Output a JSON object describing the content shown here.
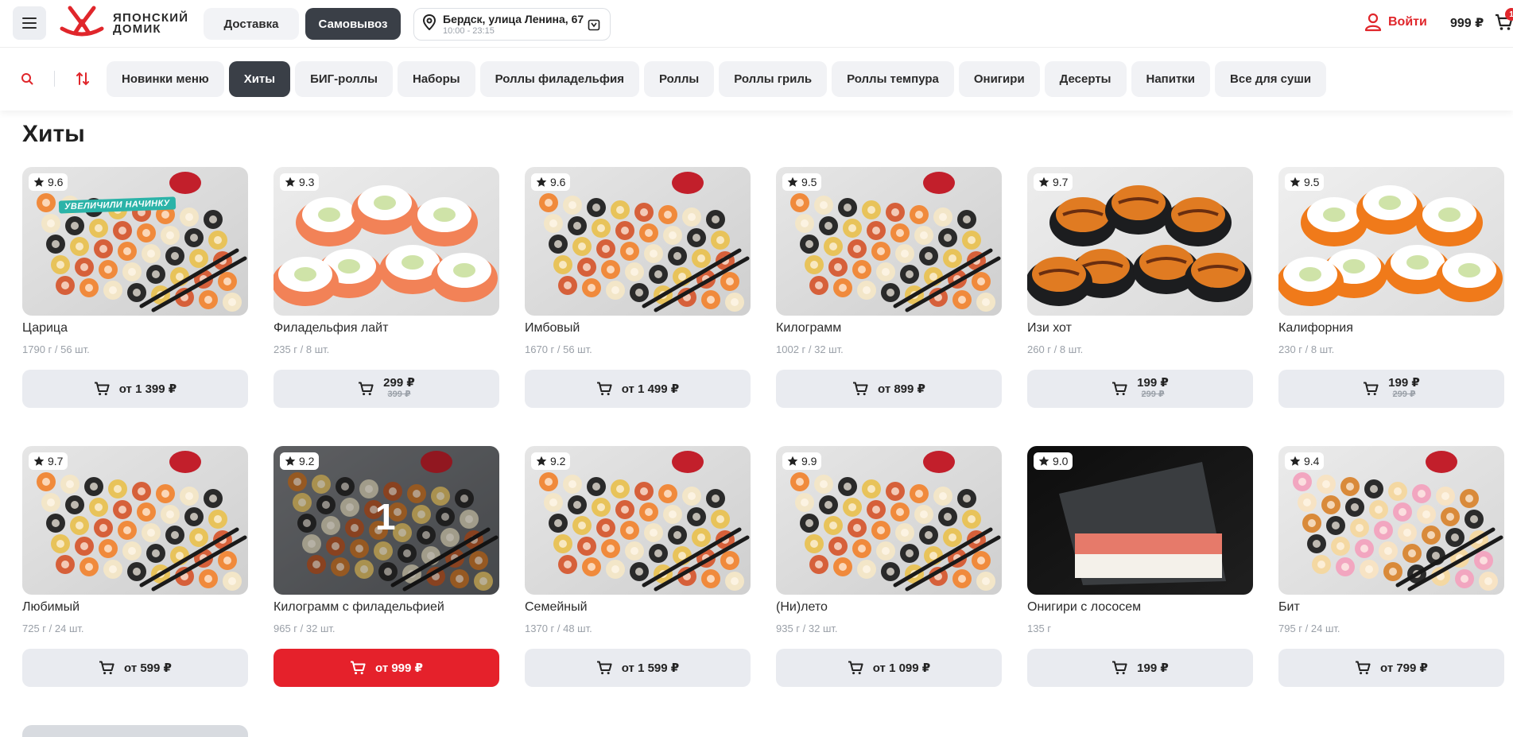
{
  "header": {
    "logo_line1": "ЯПОНСКИЙ",
    "logo_line2": "ДОМИК",
    "delivery_label": "Доставка",
    "pickup_label": "Самовывоз",
    "address": "Бердск, улица Ленина, 67",
    "hours": "10:00 - 23:15",
    "login_label": "Войти",
    "cart_total": "999 ₽",
    "cart_count": "1"
  },
  "categories": [
    {
      "label": "Новинки меню",
      "active": false
    },
    {
      "label": "Хиты",
      "active": true
    },
    {
      "label": "БИГ-роллы",
      "active": false
    },
    {
      "label": "Наборы",
      "active": false
    },
    {
      "label": "Роллы филадельфия",
      "active": false
    },
    {
      "label": "Роллы",
      "active": false
    },
    {
      "label": "Роллы гриль",
      "active": false
    },
    {
      "label": "Роллы темпура",
      "active": false
    },
    {
      "label": "Онигири",
      "active": false
    },
    {
      "label": "Десерты",
      "active": false
    },
    {
      "label": "Напитки",
      "active": false
    },
    {
      "label": "Все для суши",
      "active": false
    }
  ],
  "section": {
    "title": "Хиты"
  },
  "products": [
    {
      "name": "Царица",
      "weight": "1790 г / 56 шт.",
      "rating": "9.6",
      "price": "от 1 399 ₽",
      "old_price": "",
      "promo": "УВЕЛИЧИЛИ НАЧИНКУ",
      "button": "gray",
      "image": "set-mix"
    },
    {
      "name": "Филадельфия лайт",
      "weight": "235 г / 8 шт.",
      "rating": "9.3",
      "price": "299 ₽",
      "old_price": "399 ₽",
      "promo": "",
      "button": "gray",
      "image": "salmon-roll"
    },
    {
      "name": "Имбовый",
      "weight": "1670 г / 56 шт.",
      "rating": "9.6",
      "price": "от 1 499 ₽",
      "old_price": "",
      "promo": "",
      "button": "gray",
      "image": "set-mix"
    },
    {
      "name": "Килограмм",
      "weight": "1002 г / 32 шт.",
      "rating": "9.5",
      "price": "от 899 ₽",
      "old_price": "",
      "promo": "",
      "button": "gray",
      "image": "set-mix"
    },
    {
      "name": "Изи хот",
      "weight": "260 г / 8 шт.",
      "rating": "9.7",
      "price": "199 ₽",
      "old_price": "299 ₽",
      "promo": "",
      "button": "gray",
      "image": "baked-roll"
    },
    {
      "name": "Калифорния",
      "weight": "230 г / 8 шт.",
      "rating": "9.5",
      "price": "199 ₽",
      "old_price": "299 ₽",
      "promo": "",
      "button": "gray",
      "image": "caviar-roll"
    },
    {
      "name": "Любимый",
      "weight": "725 г / 24 шт.",
      "rating": "9.7",
      "price": "от 599 ₽",
      "old_price": "",
      "promo": "",
      "button": "gray",
      "image": "set-mix"
    },
    {
      "name": "Килограмм с филадельфией",
      "weight": "965 г / 32 шт.",
      "rating": "9.2",
      "price": "от 999 ₽",
      "old_price": "",
      "promo": "",
      "button": "red",
      "image": "set-dark",
      "overlay_number": "1"
    },
    {
      "name": "Семейный",
      "weight": "1370 г / 48 шт.",
      "rating": "9.2",
      "price": "от 1 599 ₽",
      "old_price": "",
      "promo": "",
      "button": "gray",
      "image": "set-mix"
    },
    {
      "name": "(Ни)лето",
      "weight": "935 г / 32 шт.",
      "rating": "9.9",
      "price": "от 1 099 ₽",
      "old_price": "",
      "promo": "",
      "button": "gray",
      "image": "set-mix"
    },
    {
      "name": "Онигири с лососем",
      "weight": "135 г",
      "rating": "9.0",
      "price": "199 ₽",
      "old_price": "",
      "promo": "",
      "button": "gray",
      "image": "onigiri"
    },
    {
      "name": "Бит",
      "weight": "795 г / 24 шт.",
      "rating": "9.4",
      "price": "от 799 ₽",
      "old_price": "",
      "promo": "",
      "button": "gray",
      "image": "set-pink"
    }
  ],
  "colors": {
    "accent": "#e5212b",
    "dark_pill": "#3a3f47",
    "button_gray": "#e9ebf0",
    "promo": "#2bb3a8"
  }
}
